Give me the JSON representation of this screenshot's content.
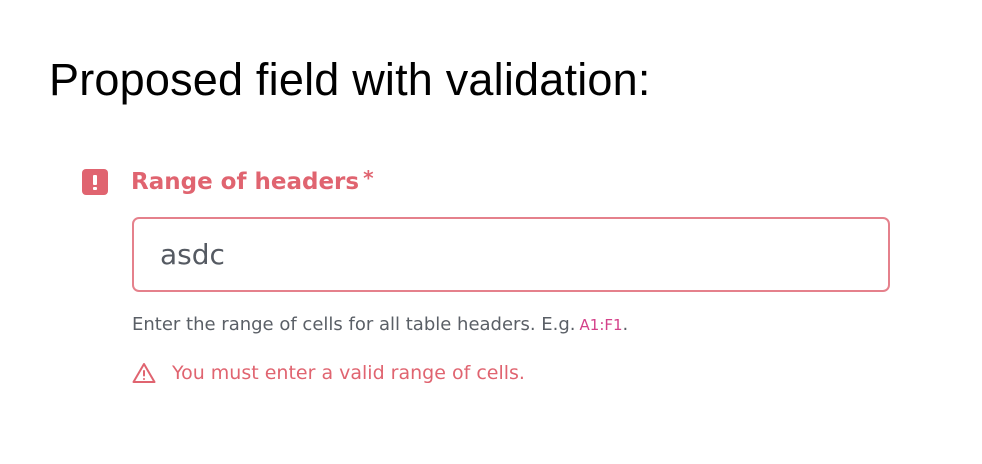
{
  "heading": "Proposed field with validation:",
  "field": {
    "label": "Range of headers",
    "required_mark": "*",
    "value": "asdc",
    "helper_text": "Enter the range of cells for all table headers. E.g.",
    "helper_example": "A1:F1",
    "helper_suffix": ".",
    "error_message": "You must enter a valid range of cells.",
    "error_badge_icon": "exclamation-icon",
    "warning_icon": "warning-triangle-icon"
  },
  "colors": {
    "error": "#e06470",
    "input_border": "#e5818c",
    "example_text": "#d4418a",
    "helper_text": "#5a5f66"
  }
}
